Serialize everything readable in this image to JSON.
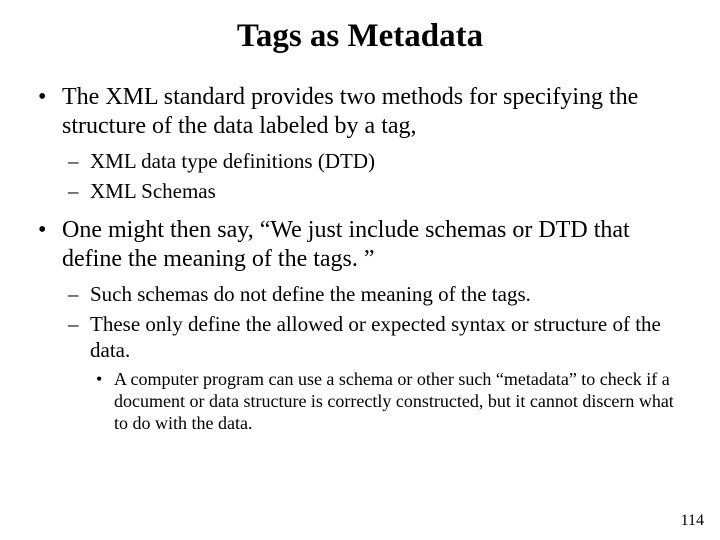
{
  "title": "Tags as Metadata",
  "bullets": {
    "b1": "The XML standard provides two methods for specifying the structure of the data labeled by a tag,",
    "b1_sub1": "XML data type definitions (DTD)",
    "b1_sub2": "XML Schemas",
    "b2": "One might then say, “We just include schemas or DTD that define the meaning of the tags. ”",
    "b2_sub1": "Such schemas do not define the meaning of the tags.",
    "b2_sub2": "These only define the allowed or expected syntax or structure of the data.",
    "b2_sub2_sub1": "A computer program can use a schema or other such “metadata” to check if a document or data structure is correctly constructed, but it cannot discern what to do with the data."
  },
  "page_number": "114"
}
